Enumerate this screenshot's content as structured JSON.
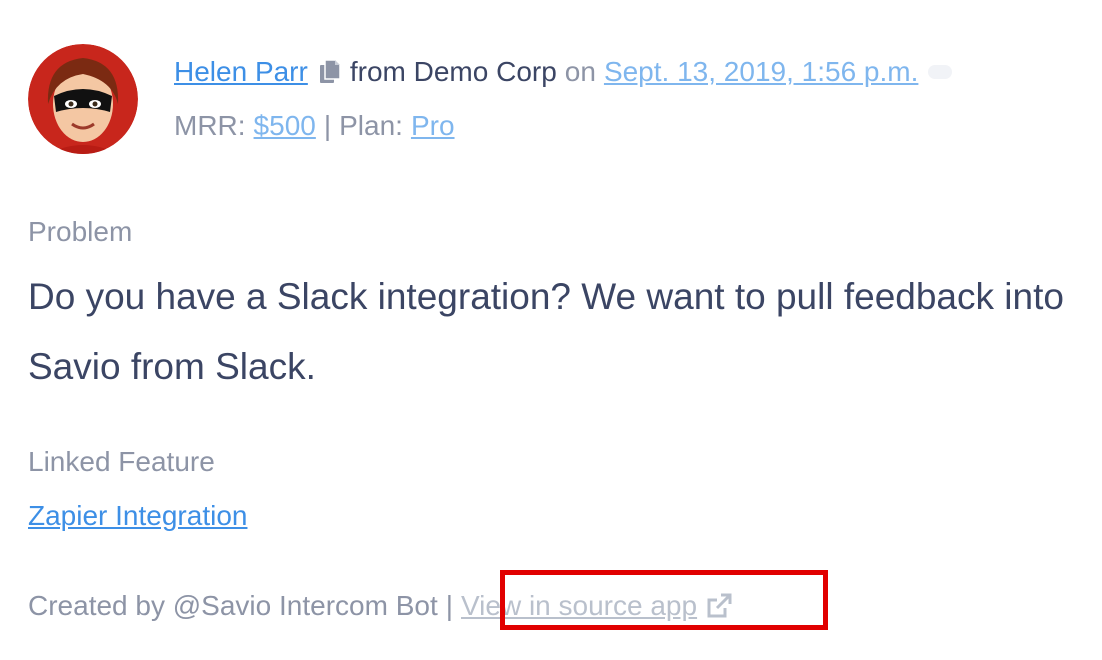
{
  "header": {
    "user_name": "Helen Parr",
    "from_text": "from Demo Corp",
    "on_text": "on",
    "date": "Sept. 13, 2019, 1:56 p.m.",
    "mrr_label": "MRR:",
    "mrr_value": "$500",
    "separator": "|",
    "plan_label": "Plan:",
    "plan_value": "Pro"
  },
  "problem": {
    "label": "Problem",
    "text": "Do you have a Slack integration? We want to pull feedback into Savio from Slack."
  },
  "linked_feature": {
    "label": "Linked Feature",
    "name": "Zapier Integration"
  },
  "footer": {
    "created_by": "Created by @Savio Intercom Bot",
    "separator": "|",
    "source_link": "View in source app"
  },
  "icons": {
    "copy": "copy-icon",
    "external_link": "external-link-icon",
    "comment_bubble": "bubble-icon"
  },
  "colors": {
    "link": "#3d8fe6",
    "link_light": "#7fb6ee",
    "text_dark": "#3b4564",
    "text_muted": "#8d94a6",
    "highlight": "#e10000"
  }
}
